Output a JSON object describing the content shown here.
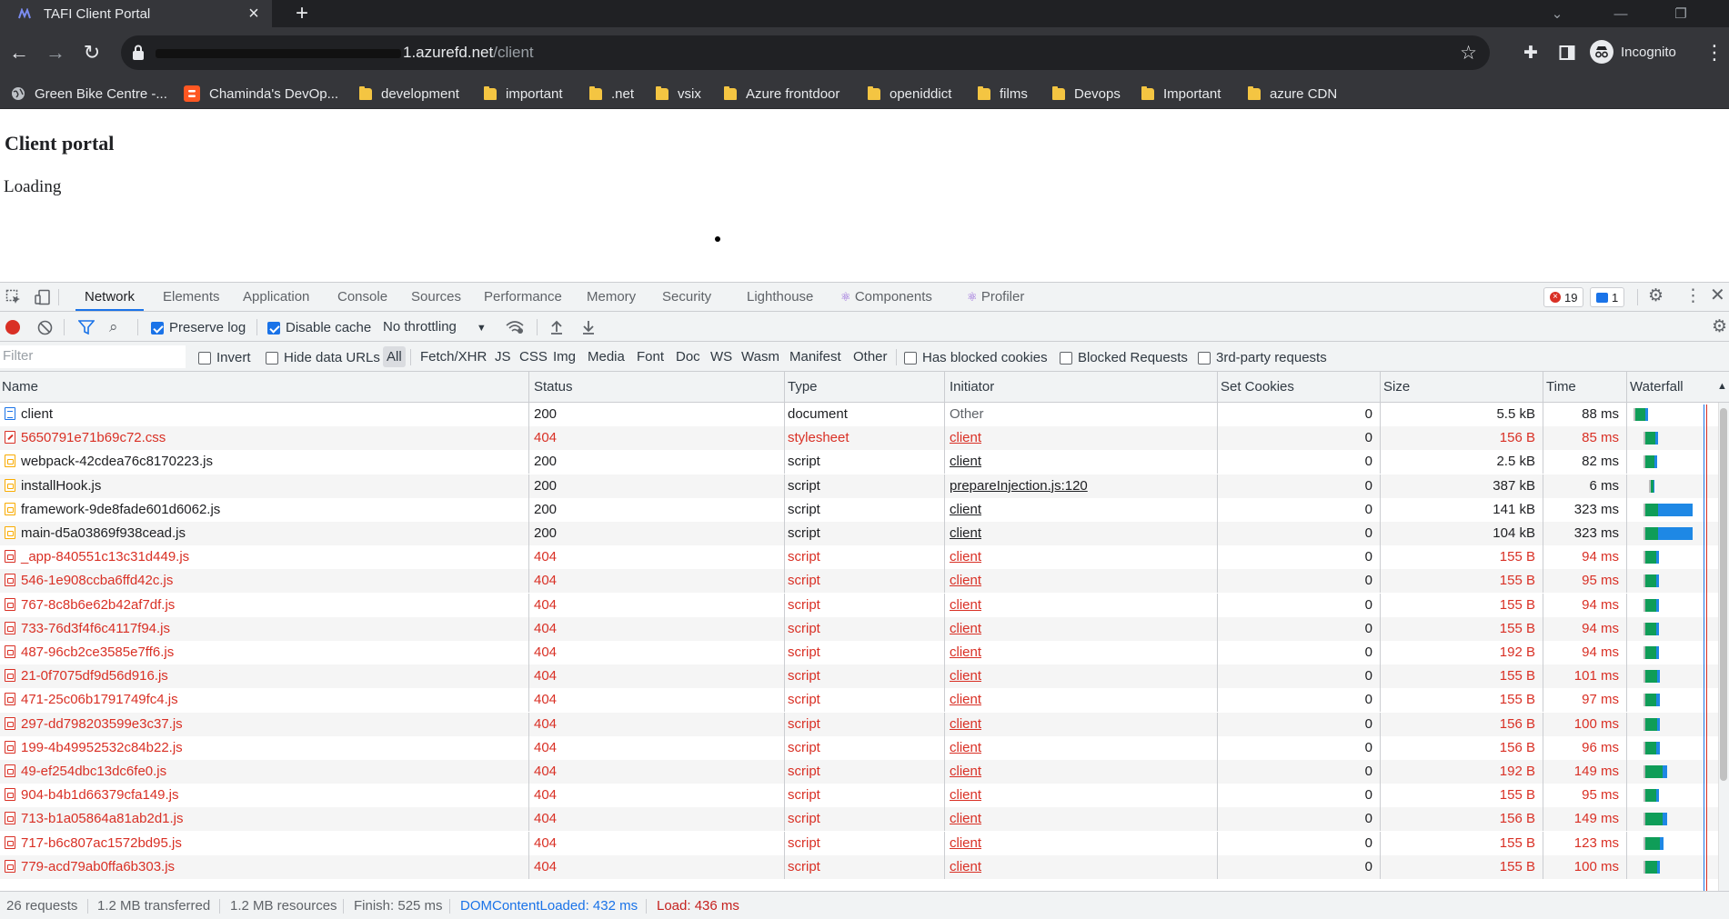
{
  "browser": {
    "tab_title": "TAFI Client Portal",
    "tab_close": "×",
    "new_tab": "+",
    "url_host_suffix": "1.azurefd.net",
    "url_path": "/client",
    "profile_label": "Incognito",
    "bookmarks": [
      {
        "label": "Green Bike Centre -...",
        "icon": "globe-icon"
      },
      {
        "label": "Chaminda's DevOp...",
        "icon": "blogger-icon"
      },
      {
        "label": "development",
        "icon": "folder-icon"
      },
      {
        "label": "important",
        "icon": "folder-icon"
      },
      {
        "label": ".net",
        "icon": "folder-icon"
      },
      {
        "label": "vsix",
        "icon": "folder-icon"
      },
      {
        "label": "Azure frontdoor",
        "icon": "folder-icon"
      },
      {
        "label": "openiddict",
        "icon": "folder-icon"
      },
      {
        "label": "films",
        "icon": "folder-icon"
      },
      {
        "label": "Devops",
        "icon": "folder-icon"
      },
      {
        "label": "Important",
        "icon": "folder-icon"
      },
      {
        "label": "azure CDN",
        "icon": "folder-icon"
      }
    ]
  },
  "page": {
    "heading": "Client portal",
    "status": "Loading"
  },
  "devtools": {
    "tabs": [
      "Network",
      "Elements",
      "Application",
      "Console",
      "Sources",
      "Performance",
      "Memory",
      "Security",
      "Lighthouse",
      "Components",
      "Profiler"
    ],
    "active_tab": "Network",
    "error_count": "19",
    "message_count": "1",
    "toolbar": {
      "preserve_log": "Preserve log",
      "disable_cache": "Disable cache",
      "throttling": "No throttling"
    },
    "filter_bar": {
      "filter_placeholder": "Filter",
      "invert": "Invert",
      "hide_data_urls": "Hide data URLs",
      "types": [
        "All",
        "Fetch/XHR",
        "JS",
        "CSS",
        "Img",
        "Media",
        "Font",
        "Doc",
        "WS",
        "Wasm",
        "Manifest",
        "Other"
      ],
      "blocked_cookies": "Has blocked cookies",
      "blocked_requests": "Blocked Requests",
      "third_party": "3rd-party requests"
    },
    "columns": [
      "Name",
      "Status",
      "Type",
      "Initiator",
      "Set Cookies",
      "Size",
      "Time",
      "Waterfall"
    ],
    "requests": [
      {
        "name": "client",
        "status": "200",
        "type": "document",
        "initiator": "Other",
        "cookies": "0",
        "size": "5.5 kB",
        "time": "88 ms",
        "kind": "doc"
      },
      {
        "name": "5650791e71b69c72.css",
        "status": "404",
        "type": "stylesheet",
        "initiator": "client",
        "cookies": "0",
        "size": "156 B",
        "time": "85 ms",
        "kind": "css"
      },
      {
        "name": "webpack-42cdea76c8170223.js",
        "status": "200",
        "type": "script",
        "initiator": "client",
        "cookies": "0",
        "size": "2.5 kB",
        "time": "82 ms",
        "kind": "js"
      },
      {
        "name": "installHook.js",
        "status": "200",
        "type": "script",
        "initiator": "prepareInjection.js:120",
        "cookies": "0",
        "size": "387 kB",
        "time": "6 ms",
        "kind": "js"
      },
      {
        "name": "framework-9de8fade601d6062.js",
        "status": "200",
        "type": "script",
        "initiator": "client",
        "cookies": "0",
        "size": "141 kB",
        "time": "323 ms",
        "kind": "js"
      },
      {
        "name": "main-d5a03869f938cead.js",
        "status": "200",
        "type": "script",
        "initiator": "client",
        "cookies": "0",
        "size": "104 kB",
        "time": "323 ms",
        "kind": "js"
      },
      {
        "name": "_app-840551c13c31d449.js",
        "status": "404",
        "type": "script",
        "initiator": "client",
        "cookies": "0",
        "size": "155 B",
        "time": "94 ms",
        "kind": "jserr"
      },
      {
        "name": "546-1e908ccba6ffd42c.js",
        "status": "404",
        "type": "script",
        "initiator": "client",
        "cookies": "0",
        "size": "155 B",
        "time": "95 ms",
        "kind": "jserr"
      },
      {
        "name": "767-8c8b6e62b42af7df.js",
        "status": "404",
        "type": "script",
        "initiator": "client",
        "cookies": "0",
        "size": "155 B",
        "time": "94 ms",
        "kind": "jserr"
      },
      {
        "name": "733-76d3f4f6c4117f94.js",
        "status": "404",
        "type": "script",
        "initiator": "client",
        "cookies": "0",
        "size": "155 B",
        "time": "94 ms",
        "kind": "jserr"
      },
      {
        "name": "487-96cb2ce3585e7ff6.js",
        "status": "404",
        "type": "script",
        "initiator": "client",
        "cookies": "0",
        "size": "192 B",
        "time": "94 ms",
        "kind": "jserr"
      },
      {
        "name": "21-0f7075df9d56d916.js",
        "status": "404",
        "type": "script",
        "initiator": "client",
        "cookies": "0",
        "size": "155 B",
        "time": "101 ms",
        "kind": "jserr"
      },
      {
        "name": "471-25c06b1791749fc4.js",
        "status": "404",
        "type": "script",
        "initiator": "client",
        "cookies": "0",
        "size": "155 B",
        "time": "97 ms",
        "kind": "jserr"
      },
      {
        "name": "297-dd798203599e3c37.js",
        "status": "404",
        "type": "script",
        "initiator": "client",
        "cookies": "0",
        "size": "156 B",
        "time": "100 ms",
        "kind": "jserr"
      },
      {
        "name": "199-4b49952532c84b22.js",
        "status": "404",
        "type": "script",
        "initiator": "client",
        "cookies": "0",
        "size": "156 B",
        "time": "96 ms",
        "kind": "jserr"
      },
      {
        "name": "49-ef254dbc13dc6fe0.js",
        "status": "404",
        "type": "script",
        "initiator": "client",
        "cookies": "0",
        "size": "192 B",
        "time": "149 ms",
        "kind": "jserr"
      },
      {
        "name": "904-b4b1d66379cfa149.js",
        "status": "404",
        "type": "script",
        "initiator": "client",
        "cookies": "0",
        "size": "155 B",
        "time": "95 ms",
        "kind": "jserr"
      },
      {
        "name": "713-b1a05864a81ab2d1.js",
        "status": "404",
        "type": "script",
        "initiator": "client",
        "cookies": "0",
        "size": "156 B",
        "time": "149 ms",
        "kind": "jserr"
      },
      {
        "name": "717-b6c807ac1572bd95.js",
        "status": "404",
        "type": "script",
        "initiator": "client",
        "cookies": "0",
        "size": "155 B",
        "time": "123 ms",
        "kind": "jserr"
      },
      {
        "name": "779-acd79ab0ffa6b303.js",
        "status": "404",
        "type": "script",
        "initiator": "client",
        "cookies": "0",
        "size": "155 B",
        "time": "100 ms",
        "kind": "jserr"
      }
    ],
    "summary": {
      "requests": "26 requests",
      "transferred": "1.2 MB transferred",
      "resources": "1.2 MB resources",
      "finish": "Finish: 525 ms",
      "dom_content_loaded": "DOMContentLoaded: 432 ms",
      "load": "Load: 436 ms"
    },
    "colors": {
      "error": "#d93025",
      "accent": "#1a73e8",
      "waterfall_green": "#0f9d58",
      "waterfall_blue": "#1e88e5"
    }
  }
}
